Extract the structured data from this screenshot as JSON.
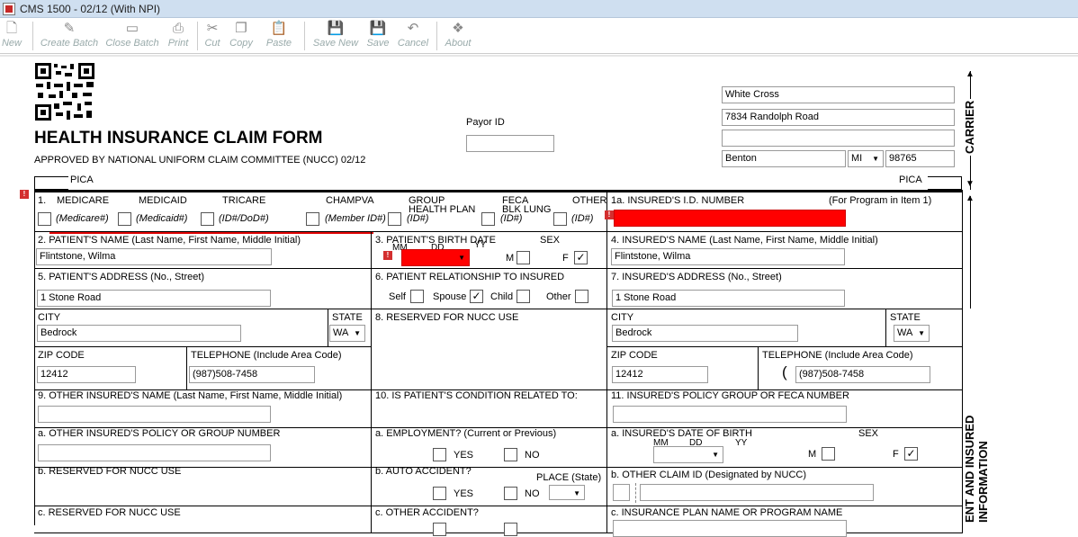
{
  "window": {
    "title": "CMS 1500 - 02/12  (With NPI)"
  },
  "toolbar": {
    "new": "New",
    "create_batch": "Create Batch",
    "close_batch": "Close Batch",
    "print": "Print",
    "cut": "Cut",
    "copy": "Copy",
    "paste": "Paste",
    "save_new": "Save New",
    "save": "Save",
    "cancel": "Cancel",
    "about": "About"
  },
  "form": {
    "title": "HEALTH INSURANCE CLAIM FORM",
    "subtitle": "APPROVED BY NATIONAL UNIFORM CLAIM COMMITTEE (NUCC) 02/12",
    "pica": "PICA",
    "payor_id_label": "Payor ID",
    "payor_id": "",
    "carrier": {
      "name": "White Cross",
      "address": "7834 Randolph Road",
      "address2": "",
      "city": "Benton",
      "state": "MI",
      "zip": "98765"
    },
    "carrier_side": "CARRIER",
    "patient_side": "ENT AND INSURED INFORMATION",
    "item1": {
      "label": "1.",
      "medicare": "MEDICARE",
      "medicaid": "MEDICAID",
      "tricare": "TRICARE",
      "champva": "CHAMPVA",
      "group": "GROUP",
      "group2": "HEALTH PLAN",
      "feca": "FECA",
      "feca2": "BLK LUNG",
      "other": "OTHER",
      "medicare_sub": "(Medicare#)",
      "medicaid_sub": "(Medicaid#)",
      "tricare_sub": "(ID#/DoD#)",
      "champva_sub": "(Member ID#)",
      "group_sub": "(ID#)",
      "feca_sub": "(ID#)",
      "other_sub": "(ID#)"
    },
    "item1a": {
      "label": "1a. INSURED'S I.D. NUMBER",
      "note": "(For Program in Item 1)"
    },
    "item2": {
      "label": "2. PATIENT'S NAME (Last Name, First Name, Middle Initial)",
      "value": "Flintstone, Wilma"
    },
    "item3": {
      "label": "3. PATIENT'S BIRTH DATE",
      "mm": "MM",
      "dd": "DD",
      "yy": "YY",
      "sex": "SEX",
      "m": "M",
      "f": "F",
      "f_mark": "✓"
    },
    "item4": {
      "label": "4. INSURED'S NAME (Last Name, First Name, Middle Initial)",
      "value": "Flintstone, Wilma"
    },
    "item5": {
      "label": "5. PATIENT'S ADDRESS (No., Street)",
      "value": "1 Stone Road",
      "city_label": "CITY",
      "city": "Bedrock",
      "state_label": "STATE",
      "state": "WA",
      "zip_label": "ZIP CODE",
      "zip": "12412",
      "phone_label": "TELEPHONE (Include Area Code)",
      "phone": "(987)508-7458"
    },
    "item6": {
      "label": "6. PATIENT RELATIONSHIP TO INSURED",
      "self": "Self",
      "spouse": "Spouse",
      "child": "Child",
      "other": "Other",
      "spouse_mark": "✓"
    },
    "item7": {
      "label": "7. INSURED'S ADDRESS (No., Street)",
      "value": "1 Stone Road",
      "city_label": "CITY",
      "city": "Bedrock",
      "state_label": "STATE",
      "state": "WA",
      "zip_label": "ZIP CODE",
      "zip": "12412",
      "phone_label": "TELEPHONE (Include Area Code)",
      "paren": "(",
      "phone": "(987)508-7458"
    },
    "item8": {
      "label": "8. RESERVED FOR NUCC USE"
    },
    "item9": {
      "label": "9. OTHER INSURED'S NAME (Last Name, First Name, Middle Initial)",
      "value": "",
      "a_label": "a. OTHER INSURED'S POLICY OR GROUP NUMBER",
      "a_value": "",
      "b_label": "b. RESERVED FOR NUCC USE",
      "c_label": "c. RESERVED FOR NUCC USE"
    },
    "item10": {
      "label": "10. IS PATIENT'S CONDITION RELATED TO:",
      "a_label": "a. EMPLOYMENT? (Current or Previous)",
      "b_label": "b. AUTO ACCIDENT?",
      "c_label": "c. OTHER ACCIDENT?",
      "yes": "YES",
      "no": "NO",
      "place": "PLACE (State)"
    },
    "item11": {
      "label": "11. INSURED'S POLICY GROUP OR FECA NUMBER",
      "value": "",
      "a_label": "a. INSURED'S DATE OF BIRTH",
      "mm": "MM",
      "dd": "DD",
      "yy": "YY",
      "sex": "SEX",
      "m": "M",
      "f": "F",
      "f_mark": "✓",
      "b_label": "b. OTHER CLAIM ID (Designated by NUCC)",
      "c_label": "c. INSURANCE PLAN NAME OR PROGRAM NAME"
    }
  },
  "colors": {
    "error": "#ff0000",
    "titlebar": "#cfdff0"
  }
}
